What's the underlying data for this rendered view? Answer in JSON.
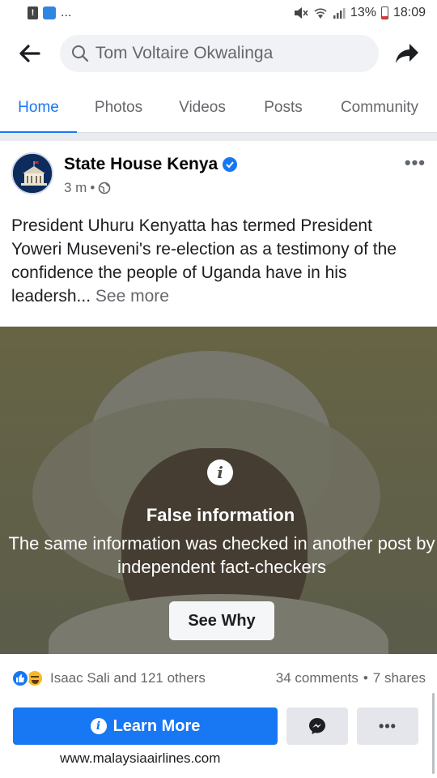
{
  "status_bar": {
    "notif_more": "...",
    "battery": "13%",
    "time": "18:09"
  },
  "search": {
    "query": "Tom Voltaire Okwalinga"
  },
  "tabs": [
    {
      "label": "Home",
      "active": true
    },
    {
      "label": "Photos",
      "active": false
    },
    {
      "label": "Videos",
      "active": false
    },
    {
      "label": "Posts",
      "active": false
    },
    {
      "label": "Community",
      "active": false
    }
  ],
  "post": {
    "page_name": "State House Kenya",
    "time": "3 m",
    "separator": "•",
    "text": "President Uhuru Kenyatta has termed President Yoweri Museveni's re-election as a testimony of the confidence the people of Uganda have in his leadersh...",
    "see_more": "See more",
    "more_menu": "•••"
  },
  "fact_check": {
    "icon": "i",
    "title": "False information",
    "description": "The same information was checked in another post by independent fact-checkers",
    "button": "See Why"
  },
  "engagement": {
    "reactors": "Isaac Sali and 121 others",
    "comments": "34 comments",
    "separator": "•",
    "shares": "7 shares"
  },
  "actions": {
    "learn_more": "Learn More",
    "more": "•••",
    "url": "www.malaysiaairlines.com"
  },
  "colors": {
    "accent": "#1877f2",
    "divider": "#e9ebee"
  }
}
